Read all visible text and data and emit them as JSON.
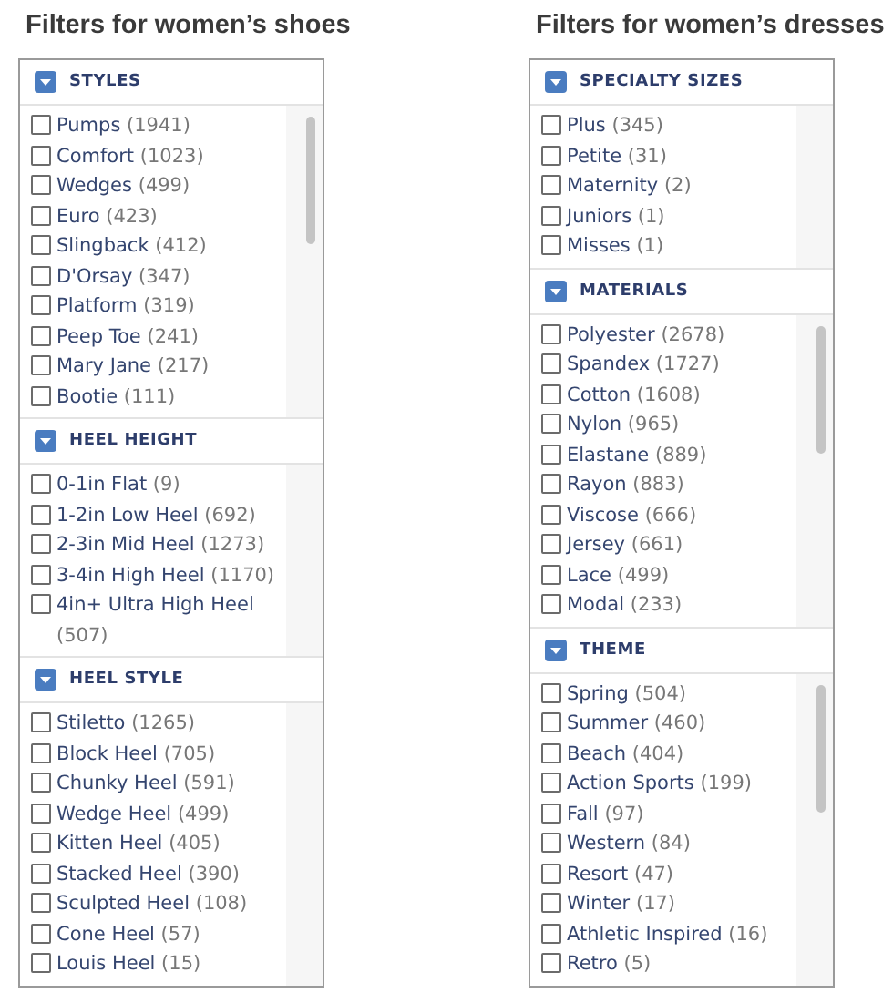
{
  "panels": [
    {
      "title": "Filters for women’s shoes",
      "sections": [
        {
          "heading": "STYLES",
          "expanded": true,
          "scrollbar": true,
          "items": [
            {
              "name": "Pumps",
              "count": "(1941)",
              "checked": false
            },
            {
              "name": "Comfort",
              "count": "(1023)",
              "checked": false
            },
            {
              "name": "Wedges",
              "count": "(499)",
              "checked": false
            },
            {
              "name": "Euro",
              "count": "(423)",
              "checked": false
            },
            {
              "name": "Slingback",
              "count": "(412)",
              "checked": false
            },
            {
              "name": "D'Orsay",
              "count": "(347)",
              "checked": false
            },
            {
              "name": "Platform",
              "count": "(319)",
              "checked": false
            },
            {
              "name": "Peep Toe",
              "count": "(241)",
              "checked": false
            },
            {
              "name": "Mary Jane",
              "count": "(217)",
              "checked": false
            },
            {
              "name": "Bootie",
              "count": "(111)",
              "checked": false
            }
          ]
        },
        {
          "heading": "HEEL HEIGHT",
          "expanded": true,
          "scrollbar": false,
          "items": [
            {
              "name": "0-1in Flat",
              "count": "(9)",
              "checked": false
            },
            {
              "name": "1-2in Low Heel",
              "count": "(692)",
              "checked": false
            },
            {
              "name": "2-3in Mid Heel",
              "count": "(1273)",
              "checked": false
            },
            {
              "name": "3-4in High Heel",
              "count": "(1170)",
              "checked": false
            },
            {
              "name": "4in+ Ultra High Heel",
              "count": "(507)",
              "checked": false
            }
          ]
        },
        {
          "heading": "HEEL STYLE",
          "expanded": true,
          "scrollbar": false,
          "items": [
            {
              "name": "Stiletto",
              "count": "(1265)",
              "checked": false
            },
            {
              "name": "Block Heel",
              "count": "(705)",
              "checked": false
            },
            {
              "name": "Chunky Heel",
              "count": "(591)",
              "checked": false
            },
            {
              "name": "Wedge Heel",
              "count": "(499)",
              "checked": false
            },
            {
              "name": "Kitten Heel",
              "count": "(405)",
              "checked": false
            },
            {
              "name": "Stacked Heel",
              "count": "(390)",
              "checked": false
            },
            {
              "name": "Sculpted Heel",
              "count": "(108)",
              "checked": false
            },
            {
              "name": "Cone Heel",
              "count": "(57)",
              "checked": false
            },
            {
              "name": "Louis Heel",
              "count": "(15)",
              "checked": false
            }
          ]
        }
      ]
    },
    {
      "title": "Filters for women’s dresses",
      "sections": [
        {
          "heading": "SPECIALTY SIZES",
          "expanded": true,
          "scrollbar": false,
          "items": [
            {
              "name": "Plus",
              "count": "(345)",
              "checked": false
            },
            {
              "name": "Petite",
              "count": "(31)",
              "checked": false
            },
            {
              "name": "Maternity",
              "count": "(2)",
              "checked": false
            },
            {
              "name": "Juniors",
              "count": "(1)",
              "checked": false
            },
            {
              "name": "Misses",
              "count": "(1)",
              "checked": false
            }
          ]
        },
        {
          "heading": "MATERIALS",
          "expanded": true,
          "scrollbar": true,
          "items": [
            {
              "name": "Polyester",
              "count": "(2678)",
              "checked": false
            },
            {
              "name": "Spandex",
              "count": "(1727)",
              "checked": false
            },
            {
              "name": "Cotton",
              "count": "(1608)",
              "checked": false
            },
            {
              "name": "Nylon",
              "count": "(965)",
              "checked": false
            },
            {
              "name": "Elastane",
              "count": "(889)",
              "checked": false
            },
            {
              "name": "Rayon",
              "count": "(883)",
              "checked": false
            },
            {
              "name": "Viscose",
              "count": "(666)",
              "checked": false
            },
            {
              "name": "Jersey",
              "count": "(661)",
              "checked": false
            },
            {
              "name": "Lace",
              "count": "(499)",
              "checked": false
            },
            {
              "name": "Modal",
              "count": "(233)",
              "checked": false
            }
          ]
        },
        {
          "heading": "THEME",
          "expanded": true,
          "scrollbar": true,
          "items": [
            {
              "name": "Spring",
              "count": "(504)",
              "checked": false
            },
            {
              "name": "Summer",
              "count": "(460)",
              "checked": false
            },
            {
              "name": "Beach",
              "count": "(404)",
              "checked": false
            },
            {
              "name": "Action Sports",
              "count": "(199)",
              "checked": false
            },
            {
              "name": "Fall",
              "count": "(97)",
              "checked": false
            },
            {
              "name": "Western",
              "count": "(84)",
              "checked": false
            },
            {
              "name": "Resort",
              "count": "(47)",
              "checked": false
            },
            {
              "name": "Winter",
              "count": "(17)",
              "checked": false
            },
            {
              "name": "Athletic Inspired",
              "count": "(16)",
              "checked": false
            },
            {
              "name": "Retro",
              "count": "(5)",
              "checked": false
            }
          ]
        }
      ]
    }
  ]
}
